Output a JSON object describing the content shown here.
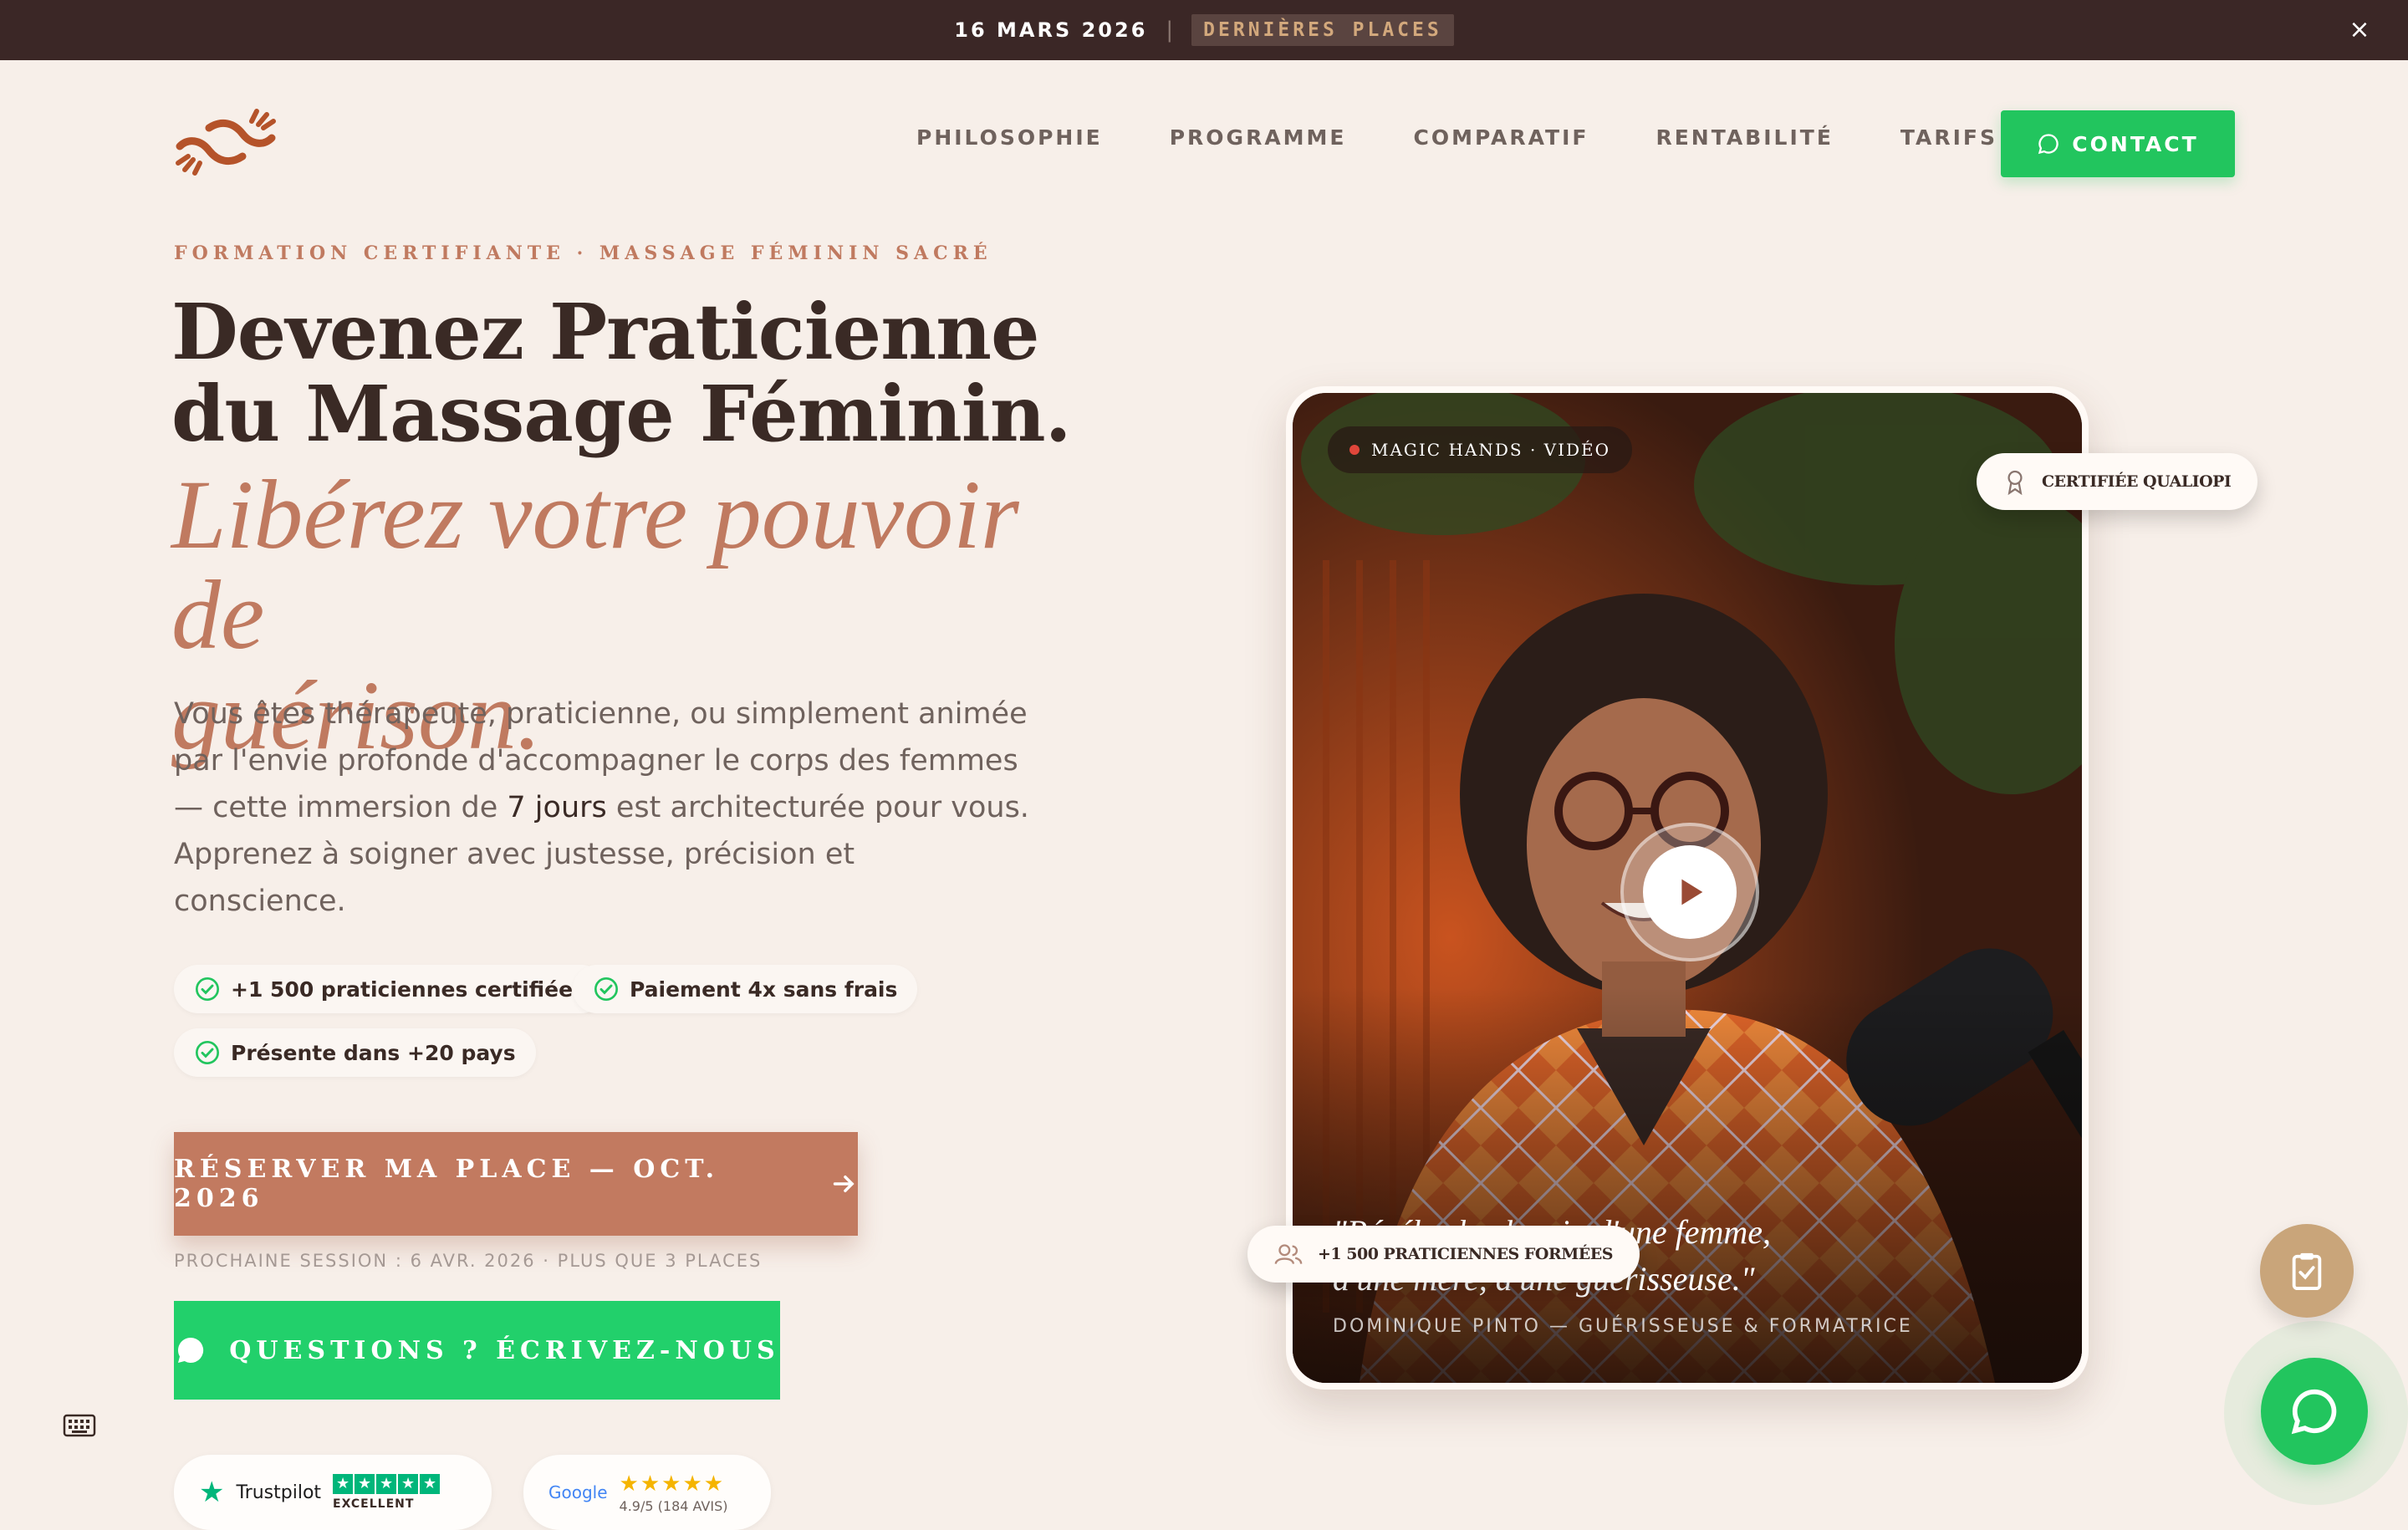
{
  "topbar": {
    "date": "16 MARS 2026",
    "separator": "|",
    "badge": "DERNIÈRES PLACES",
    "close_icon": "×"
  },
  "header": {
    "logo_icon": "hands-logo-icon",
    "nav": [
      "PHILOSOPHIE",
      "PROGRAMME",
      "COMPARATIF",
      "RENTABILITÉ",
      "TARIFS"
    ],
    "contact_label": "CONTACT"
  },
  "hero": {
    "eyebrow": "FORMATION CERTIFIANTE · MASSAGE FÉMININ SACRÉ",
    "title_line1": "Devenez Praticienne",
    "title_line2": "du Massage Féminin.",
    "accent_line1": "Libérez votre pouvoir de",
    "accent_line2": "guérison.",
    "lead_before": "Vous êtes thérapeute, praticienne, ou simplement animée par l'envie profonde d'accompagner le corps des femmes — cette immersion de ",
    "lead_highlight": "7 jours",
    "lead_after": " est architecturée pour vous. Apprenez à soigner avec justesse, précision et conscience.",
    "chips": [
      "+1 500 praticiennes certifiées",
      "Paiement 4x sans frais",
      "Présente dans +20 pays"
    ],
    "cta_primary": "RÉSERVER MA PLACE — OCT. 2026",
    "cta_note": "PROCHAINE SESSION : 6 AVR. 2026 · PLUS QUE 3 PLACES",
    "cta_whatsapp": "QUESTIONS ? ÉCRIVEZ-NOUS"
  },
  "reviews": {
    "trustpilot": {
      "brand": "Trustpilot",
      "rating_label": "EXCELLENT"
    },
    "google": {
      "brand": "Google",
      "rating": "4.9/5",
      "count": "(184 AVIS)"
    }
  },
  "video": {
    "tag": "MAGIC HANDS · VIDÉO",
    "certified": "CERTIFIÉE QUALIOPI",
    "trained": "+1 500 PRATICIENNES FORMÉES",
    "quote_line1": "\"Révéler le chemin d'une femme,",
    "quote_line2": "d'une mère, d'une guérisseuse.\"",
    "author": "DOMINIQUE PINTO — GUÉRISSEUSE & FORMATRICE"
  },
  "colors": {
    "accent": "#c07a60",
    "whatsapp": "#22c55e",
    "topbar": "#3b2726",
    "background": "#f7efe9"
  }
}
